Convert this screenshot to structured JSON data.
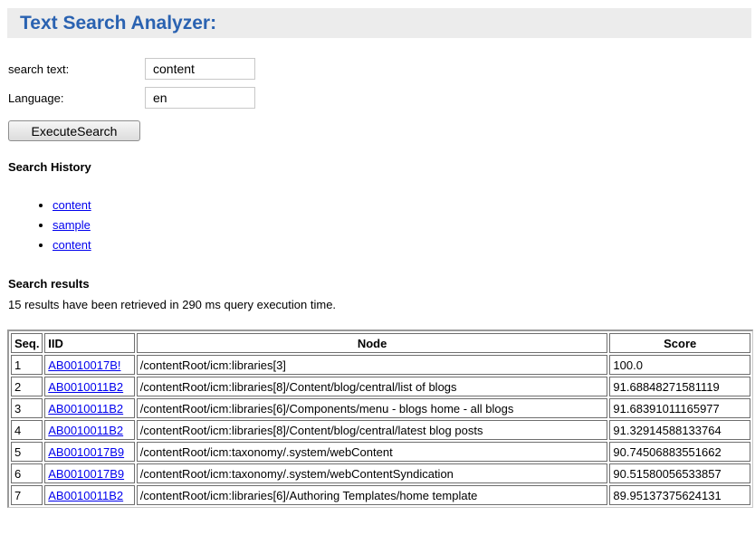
{
  "app": {
    "title": "Text Search Analyzer:"
  },
  "form": {
    "search_label": "search text:",
    "search_value": "content",
    "language_label": "Language:",
    "language_value": "en",
    "execute_label": "ExecuteSearch"
  },
  "history": {
    "title": "Search History",
    "items": [
      "content",
      "sample",
      "content"
    ]
  },
  "results": {
    "title": "Search results",
    "summary": "15 results have been retrieved in 290 ms query execution time.",
    "columns": [
      "Seq.",
      "IID",
      "Node",
      "Score"
    ],
    "rows": [
      {
        "seq": "1",
        "iid": "AB0010017B!",
        "node": "/contentRoot/icm:libraries[3]",
        "score": "100.0"
      },
      {
        "seq": "2",
        "iid": "AB0010011B2",
        "node": "/contentRoot/icm:libraries[8]/Content/blog/central/list of blogs",
        "score": "91.68848271581119"
      },
      {
        "seq": "3",
        "iid": "AB0010011B2",
        "node": "/contentRoot/icm:libraries[6]/Components/menu - blogs home - all blogs",
        "score": "91.68391011165977"
      },
      {
        "seq": "4",
        "iid": "AB0010011B2",
        "node": "/contentRoot/icm:libraries[8]/Content/blog/central/latest blog posts",
        "score": "91.32914588133764"
      },
      {
        "seq": "5",
        "iid": "AB0010017B9",
        "node": "/contentRoot/icm:taxonomy/.system/webContent",
        "score": "90.74506883551662"
      },
      {
        "seq": "6",
        "iid": "AB0010017B9",
        "node": "/contentRoot/icm:taxonomy/.system/webContentSyndication",
        "score": "90.51580056533857"
      },
      {
        "seq": "7",
        "iid": "AB0010011B2",
        "node": "/contentRoot/icm:libraries[6]/Authoring Templates/home template",
        "score": "89.95137375624131"
      }
    ]
  }
}
